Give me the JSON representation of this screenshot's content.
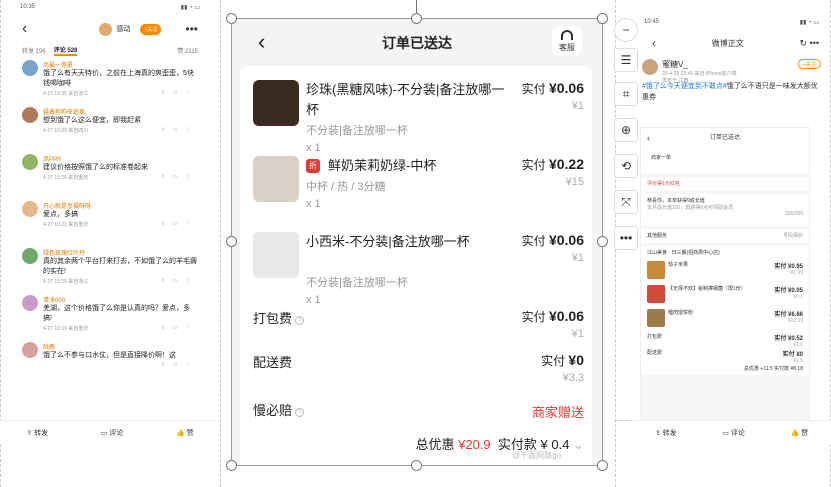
{
  "left": {
    "status_time": "10:35",
    "author": "感动",
    "follow_label": "+关注",
    "tabs": {
      "repost": "转发 196",
      "comments": "评论 528",
      "likes": "赞 2115"
    },
    "comments": [
      {
        "user": "尚最一莲夏",
        "text": "饿了么有天天特价，之前在上海真的爽歪歪，5块钱喝咖啡",
        "meta": "4-27 10:35 来自浙江",
        "color": "#7aa3c8"
      },
      {
        "user": "疆着狗狗来追疯",
        "text": "想到饿了么这么便宜，即我赶紧",
        "meta": "4-27 10:29 来自四川",
        "color": "#b07a5a"
      },
      {
        "user": "凤PPR",
        "text": "建议价格按照饿了么的标准卷起来",
        "meta": "4-27 10:26 来自重庆",
        "color": "#8fb565"
      },
      {
        "user": "开心就是幸福呀呀",
        "text": "爱点，多搞",
        "meta": "4-27 10:21 来自重庆",
        "color": "#e7b78c"
      },
      {
        "user": "绿色玫瑰红叶丹",
        "text": "真的其余两个平台打来打去，不如饿了么的羊毛薅的实在!",
        "meta": "4-27 10:20 来自浙江",
        "color": "#6aa96a"
      },
      {
        "user": "清浅000",
        "text": "羌湖，这个价格饿了么你是认真的吗？爱点，多搞!",
        "meta": "4-27 10:19 来自重庆",
        "color": "#c89ac8"
      },
      {
        "user": "陪鹿",
        "text": "饿了么不参与口水仗，但是直接降价啊！这",
        "meta": "",
        "color": "#d6a0a0"
      }
    ],
    "bottom": {
      "repost": "转发",
      "comment": "评论",
      "like": "赞"
    }
  },
  "center": {
    "title": "订单已送达",
    "service": "客服",
    "items": [
      {
        "name": "珍珠(黑糖风味)-不分装|备注放哪一杯",
        "spec": "不分装|备注放哪一杯",
        "qty": "x 1",
        "pay_label": "实付",
        "pay": "¥0.06",
        "orig": "¥1",
        "tag": ""
      },
      {
        "name": "鲜奶茉莉奶绿-中杯",
        "spec": "中杯 / 热 / 3分糖",
        "qty": "x 1",
        "pay_label": "实付",
        "pay": "¥0.22",
        "orig": "¥15",
        "tag": "折"
      },
      {
        "name": "小西米-不分装|备注放哪一杯",
        "spec": "不分装|备注放哪一杯",
        "qty": "x 1",
        "pay_label": "实付",
        "pay": "¥0.06",
        "orig": "¥1",
        "tag": ""
      }
    ],
    "pack_fee": {
      "label": "打包费",
      "pay_label": "实付",
      "pay": "¥0.06",
      "orig": "¥1"
    },
    "delivery_fee": {
      "label": "配送费",
      "pay_label": "实付",
      "pay": "¥0",
      "orig": "¥3.3"
    },
    "slow_pay": {
      "label": "慢必赔",
      "value": "商家赠送"
    },
    "totals": {
      "discount_label": "总优惠",
      "discount": "¥20.9",
      "paid_label": "实付款",
      "paid": "¥ 0.4"
    }
  },
  "right": {
    "status_time": "10:45",
    "title": "微博正文",
    "user": "蜜糖V_",
    "meta": "25-4-28 19:41  来自 iPhone客户端",
    "meta2": "发布于 江西",
    "follow_label": "+关注",
    "topic": "#饿了么今天便宜到不敢点#",
    "text_rest": "饿了么不语只是一味发大额优惠券",
    "mini": {
      "title": "订单已送达",
      "pickup": "商家一单",
      "rating": "评价得1元红包",
      "promo": "恭喜你，本单获得9成长值",
      "promo_sub": "本月成长值100，再获得6点可领取会员",
      "promo_count": "306/200",
      "other": "其他服务",
      "other_r": "号码保护",
      "shop": "江山美食 · 日三餐(招商局中心店)",
      "items": [
        {
          "name": "茄子米果",
          "pay": "实付 ¥0.95",
          "orig": "¥1.99"
        },
        {
          "name": "【无择不欢】秘制捧钢菌（限1份）",
          "pay": "实付 ¥0.05",
          "orig": "¥0.1"
        },
        {
          "name": "榴肉馄饼粉",
          "pay": "实付 ¥6.66",
          "orig": "¥13.99"
        }
      ],
      "pack": {
        "label": "打包费",
        "pay": "实付 ¥0.52",
        "orig": "¥1.1"
      },
      "delivery": {
        "label": "配送费",
        "pay": "实付 ¥0",
        "orig": "¥2.5"
      },
      "total": "总优惠 +11.5  实付款 ¥8.18"
    },
    "bottom": {
      "repost": "转发",
      "comment": "评论",
      "like": "赞"
    }
  },
  "watermark": "@千面网路go"
}
